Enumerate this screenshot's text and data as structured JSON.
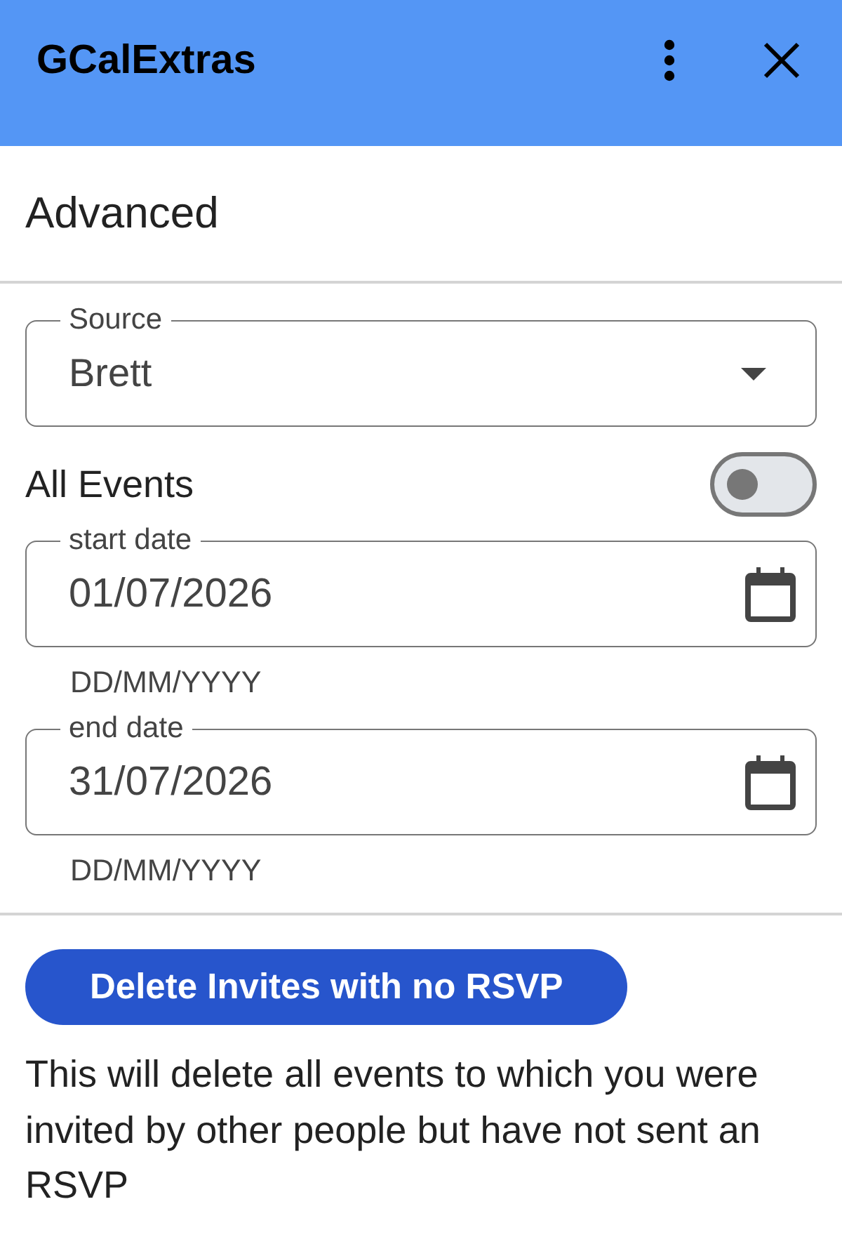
{
  "header": {
    "title": "GCalExtras"
  },
  "section": {
    "title": "Advanced"
  },
  "source": {
    "label": "Source",
    "value": "Brett"
  },
  "all_events": {
    "label": "All Events",
    "on": false
  },
  "dates": [
    {
      "label": "start date",
      "value": "01/07/2026",
      "helper": "DD/MM/YYYY"
    },
    {
      "label": "end date",
      "value": "31/07/2026",
      "helper": "DD/MM/YYYY"
    }
  ],
  "action": {
    "button": "Delete Invites with no RSVP",
    "description": "This will delete all events to which you were invited by other people but have not sent an RSVP"
  }
}
